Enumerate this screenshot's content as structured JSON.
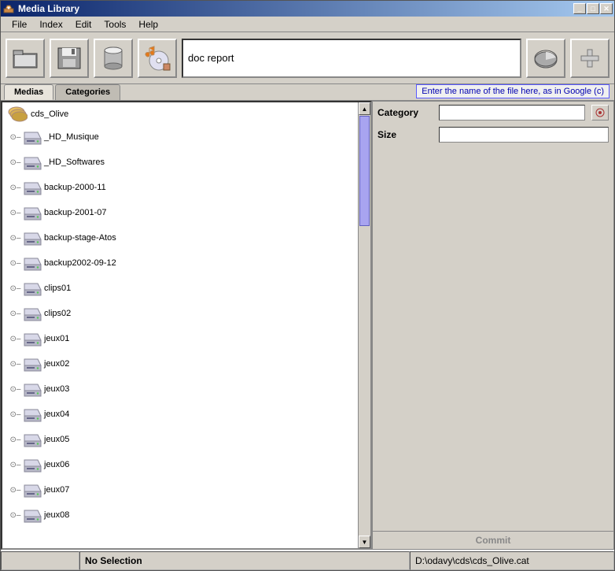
{
  "title": "Media Library",
  "menu": [
    "File",
    "Index",
    "Edit",
    "Tools",
    "Help"
  ],
  "search": {
    "value": "doc report"
  },
  "tabs": {
    "active": "Medias",
    "inactive": "Categories"
  },
  "tooltip": "Enter the name of the file here, as in Google (c)",
  "tree": {
    "root": "cds_Olive",
    "nodes": [
      "_HD_Musique",
      "_HD_Softwares",
      "backup-2000-11",
      "backup-2001-07",
      "backup-stage-Atos",
      "backup2002-09-12",
      "clips01",
      "clips02",
      "jeux01",
      "jeux02",
      "jeux03",
      "jeux04",
      "jeux05",
      "jeux06",
      "jeux07",
      "jeux08"
    ]
  },
  "details": {
    "category_label": "Category",
    "size_label": "Size",
    "category_value": "",
    "size_value": "",
    "commit": "Commit"
  },
  "status": {
    "left": "",
    "center": "No Selection",
    "right": "D:\\odavy\\cds\\cds_Olive.cat"
  }
}
